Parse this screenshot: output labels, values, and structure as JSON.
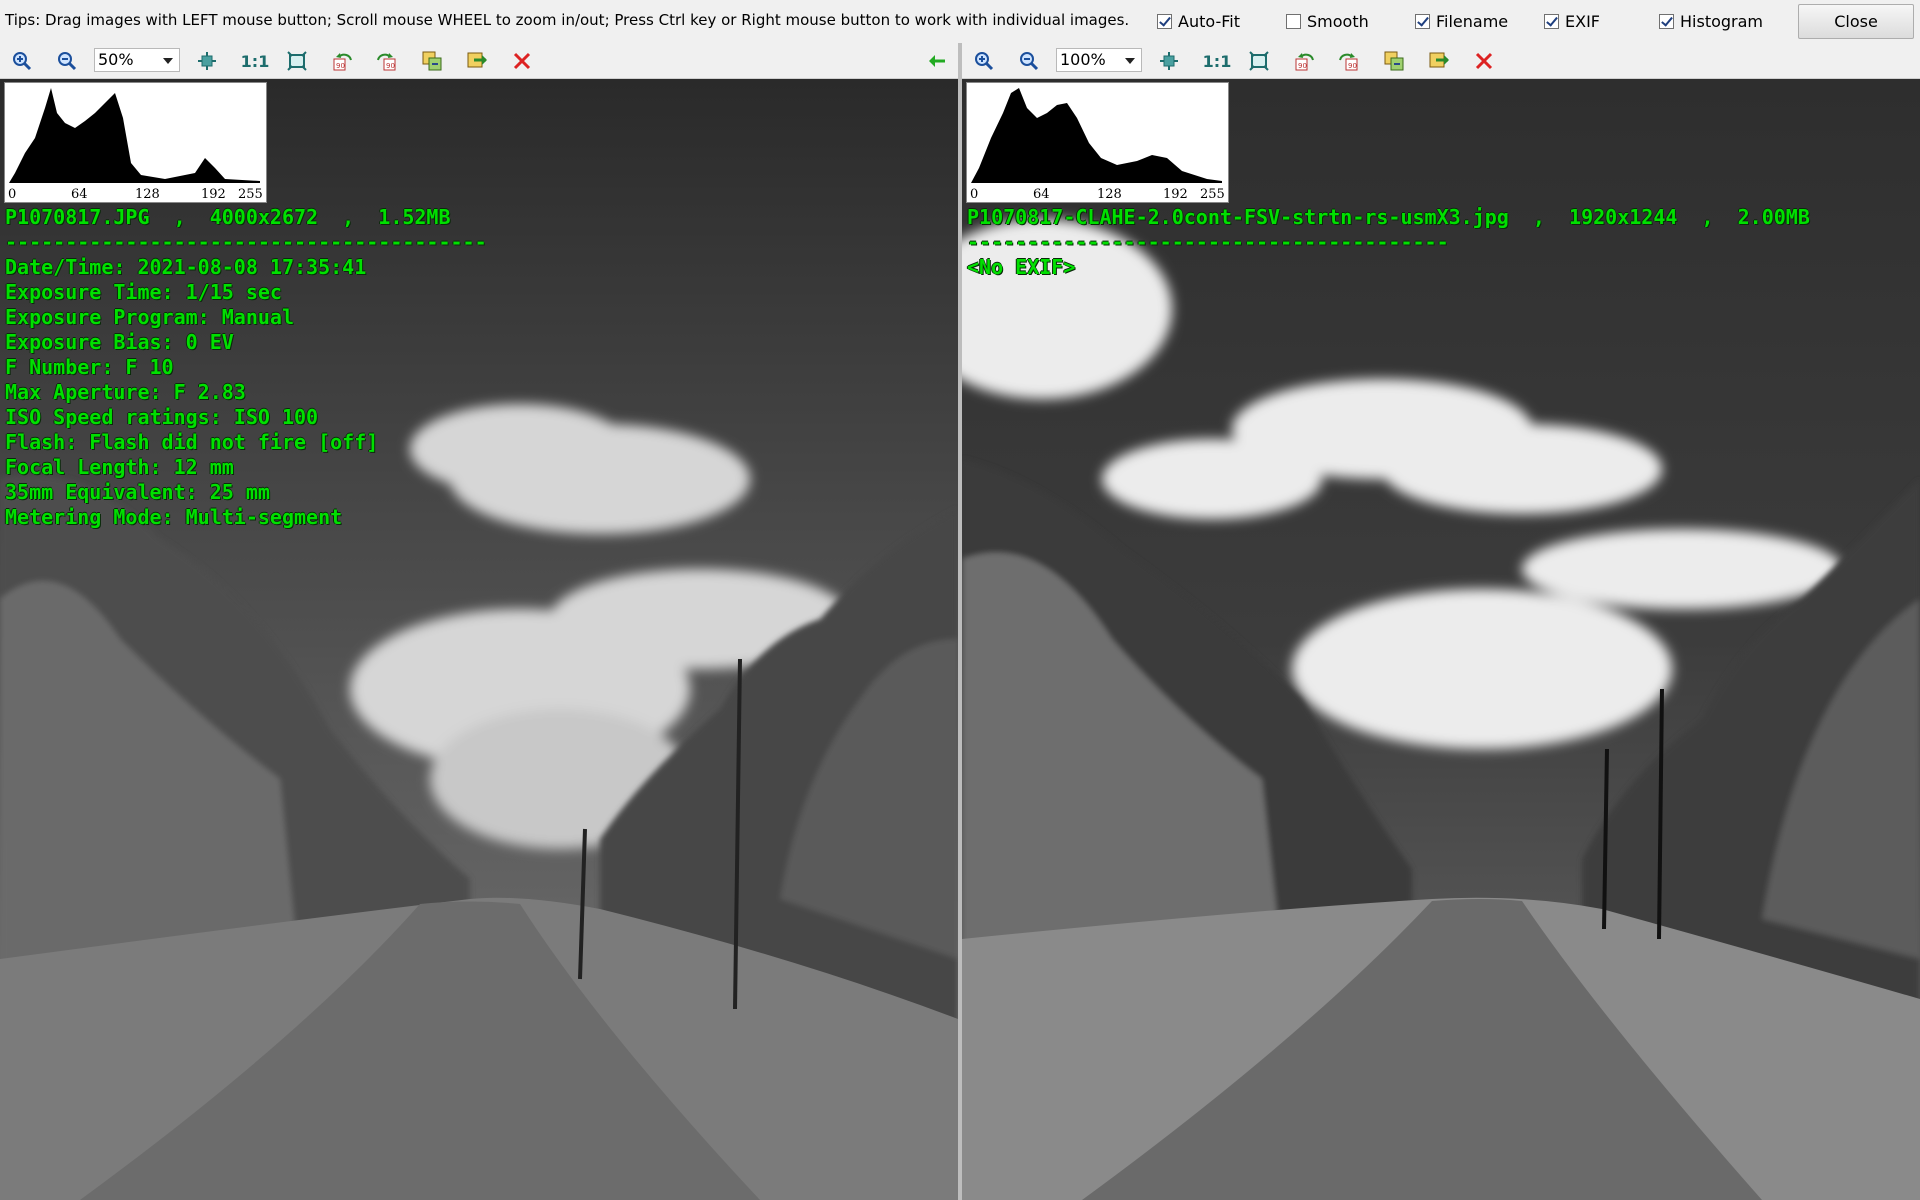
{
  "tips": "Tips: Drag images with LEFT mouse button; Scroll mouse WHEEL to zoom in/out; Press Ctrl key or Right mouse button to work with individual images.",
  "options": {
    "autofit": {
      "label": "Auto-Fit",
      "checked": true
    },
    "smooth": {
      "label": "Smooth",
      "checked": false
    },
    "filename": {
      "label": "Filename",
      "checked": true
    },
    "exif": {
      "label": "EXIF",
      "checked": true
    },
    "histogram": {
      "label": "Histogram",
      "checked": true
    }
  },
  "close_label": "Close",
  "histogram_ticks": [
    "0",
    "64",
    "128",
    "192",
    "255"
  ],
  "left": {
    "zoom": "50%",
    "file_line": "P1070817.JPG  ,  4000x2672  ,  1.52MB",
    "separator": "----------------------------------------",
    "exif": [
      "Date/Time: 2021-08-08 17:35:41",
      "Exposure Time: 1/15 sec",
      "Exposure Program: Manual",
      "Exposure Bias: 0 EV",
      "F Number: F 10",
      "Max Aperture: F 2.83",
      "ISO Speed ratings: ISO 100",
      "Flash: Flash did not fire [off]",
      "Focal Length: 12 mm",
      "35mm Equivalent: 25 mm",
      "Metering Mode: Multi-segment"
    ]
  },
  "right": {
    "zoom": "100%",
    "file_line": "P1070817-CLAHE-2.0cont-FSV-strtn-rs-usmX3.jpg  ,  1920x1244  ,  2.00MB",
    "separator": "----------------------------------------",
    "exif": [
      "<No EXIF>"
    ]
  },
  "icons": [
    "zoom-in-icon",
    "zoom-out-icon",
    "fit-icon",
    "actual-size-icon",
    "fullscreen-icon",
    "rotate-left-icon",
    "rotate-right-icon",
    "copy-image-icon",
    "move-image-icon",
    "delete-icon",
    "sync-arrow-icon"
  ],
  "colors": {
    "overlay_text": "#00e000",
    "delete": "#dd2222",
    "sync_arrow": "#22aa22"
  }
}
